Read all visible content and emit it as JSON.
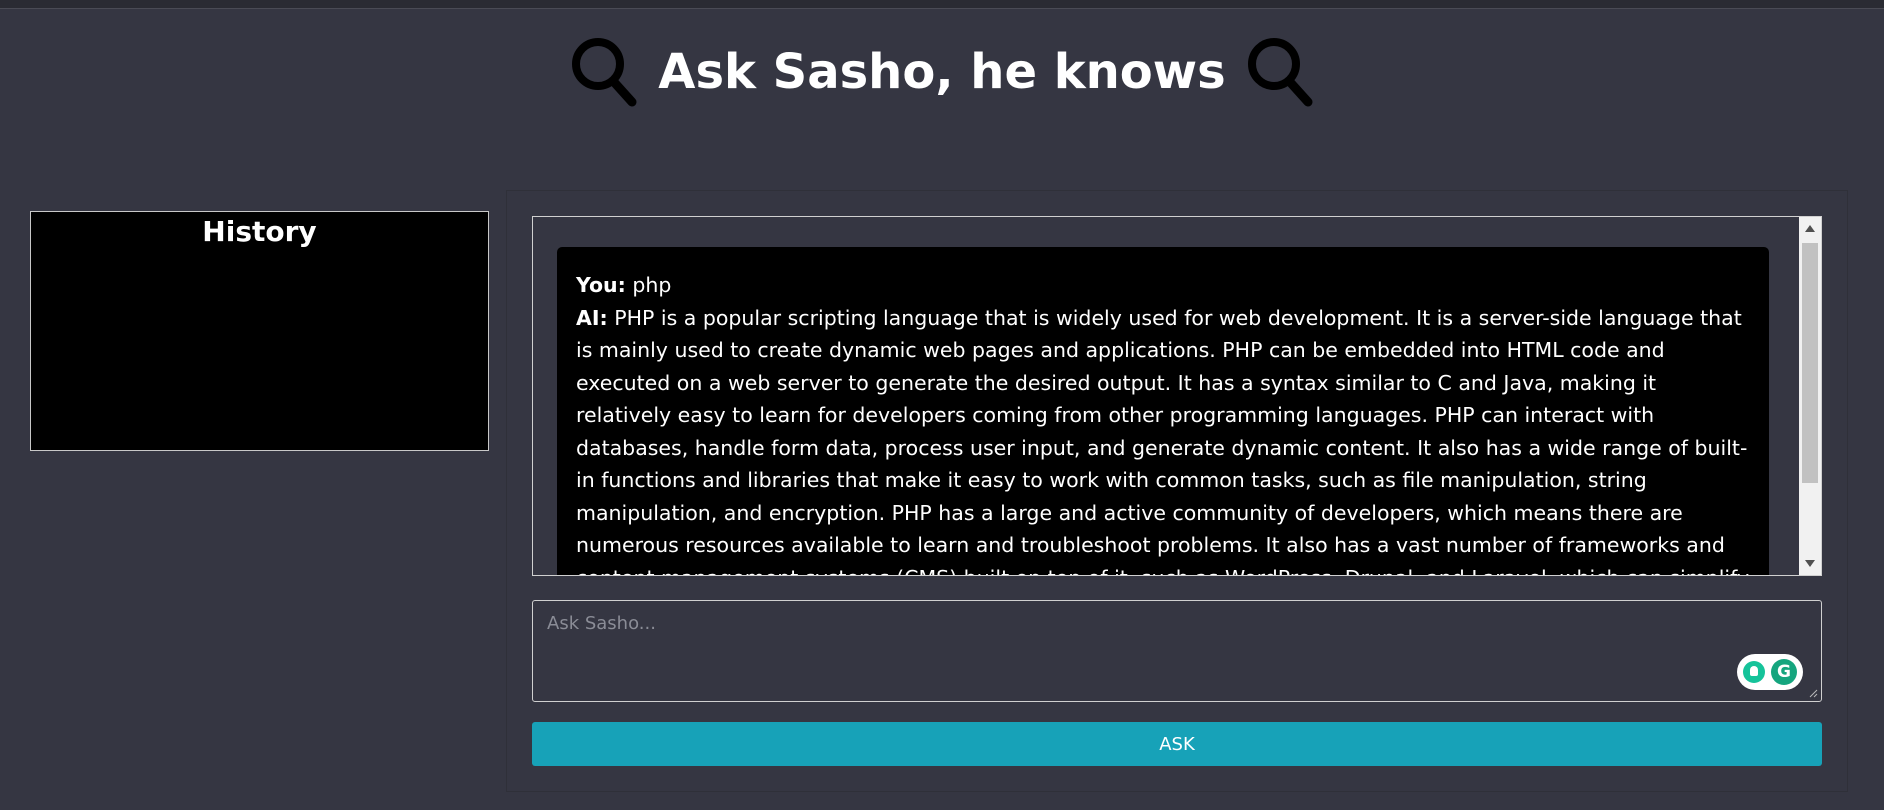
{
  "header": {
    "title": "Ask Sasho, he knows",
    "left_icon": "magnifier-icon",
    "right_icon": "magnifier-icon"
  },
  "history": {
    "title": "History"
  },
  "chat": {
    "messages": [
      {
        "user_label": "You:",
        "user_text": "php",
        "ai_label": "AI:",
        "ai_text": "PHP is a popular scripting language that is widely used for web development. It is a server-side language that is mainly used to create dynamic web pages and applications. PHP can be embedded into HTML code and executed on a web server to generate the desired output. It has a syntax similar to C and Java, making it relatively easy to learn for developers coming from other programming languages. PHP can interact with databases, handle form data, process user input, and generate dynamic content. It also has a wide range of built-in functions and libraries that make it easy to work with common tasks, such as file manipulation, string manipulation, and encryption. PHP has a large and active community of developers, which means there are numerous resources available to learn and troubleshoot problems. It also has a vast number of frameworks and content management systems (CMS) built on top of it, such as WordPress, Drupal, and Laravel, which can simplify and speed up the process of building web applications. Overall, PHP is a versatile and powerful programming language that is"
      }
    ]
  },
  "input": {
    "placeholder": "Ask Sasho...",
    "value": ""
  },
  "ask_button": {
    "label": "ASK"
  },
  "colors": {
    "background": "#353642",
    "panel_black": "#000000",
    "accent": "#17a2b8",
    "text": "#ffffff"
  }
}
